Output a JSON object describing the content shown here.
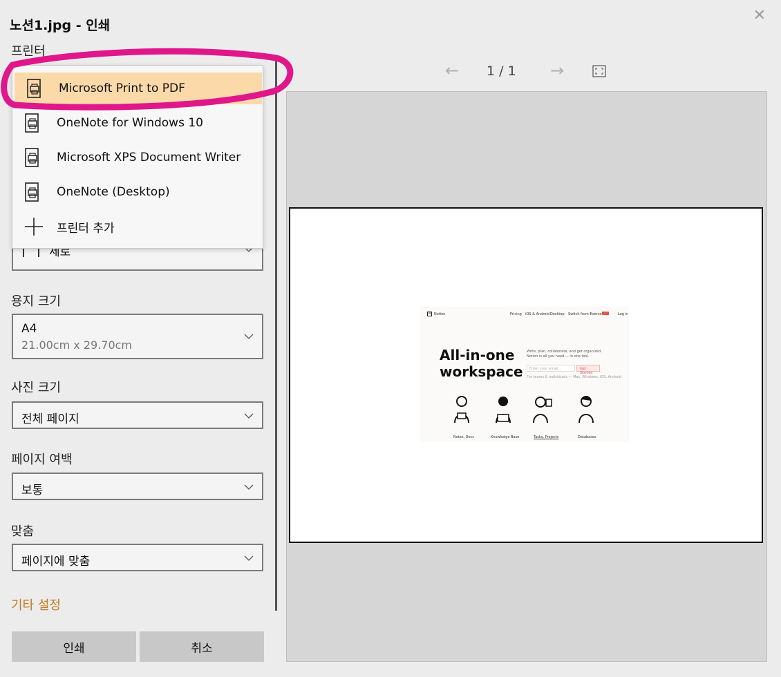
{
  "window": {
    "title": "노션1.jpg - 인쇄",
    "close_glyph": "✕"
  },
  "printer": {
    "label": "프린터",
    "options": [
      {
        "label": "Microsoft Print to PDF",
        "icon": "printer-icon",
        "selected": true
      },
      {
        "label": "OneNote for Windows 10",
        "icon": "printer-icon",
        "selected": false
      },
      {
        "label": "Microsoft XPS Document Writer",
        "icon": "printer-icon",
        "selected": false
      },
      {
        "label": "OneNote (Desktop)",
        "icon": "printer-icon",
        "selected": false
      },
      {
        "label": "프린터 추가",
        "icon": "plus-icon",
        "selected": false
      }
    ]
  },
  "orientation": {
    "value": "세로"
  },
  "paper_size": {
    "label": "용지 크기",
    "value": "A4",
    "sub": "21.00cm x 29.70cm"
  },
  "photo_size": {
    "label": "사진 크기",
    "value": "전체 페이지"
  },
  "margins": {
    "label": "페이지 여백",
    "value": "보통"
  },
  "fit": {
    "label": "맞춤",
    "value": "페이지에 맞춤"
  },
  "more_settings": "기타 설정",
  "buttons": {
    "print": "인쇄",
    "cancel": "취소"
  },
  "preview": {
    "page_indicator": "1 / 1",
    "prev_glyph": "←",
    "next_glyph": "→",
    "thumbnail": {
      "brand": "Notion",
      "nav": [
        "Pricing",
        "iOS & Android",
        "Desktop",
        "Switch from Evernote",
        "Log in"
      ],
      "headline_1": "All-in-one",
      "headline_2": "workspace",
      "desc_1": "Write, plan, collaborate, and get organized.",
      "desc_2": "Notion is all you need — in one tool.",
      "input_placeholder": "Enter your email...",
      "cta": "Get Started",
      "footnote": "For teams & individuals — Mac, Windows, iOS, Android",
      "captions": [
        "Notes, Docs",
        "Knowledge Base",
        "Tasks, Projects",
        "Databases"
      ]
    }
  },
  "colors": {
    "accent_orange": "#c47a1e",
    "selected_bg": "#fcd9a8",
    "annotation_pink": "#e0178a"
  }
}
